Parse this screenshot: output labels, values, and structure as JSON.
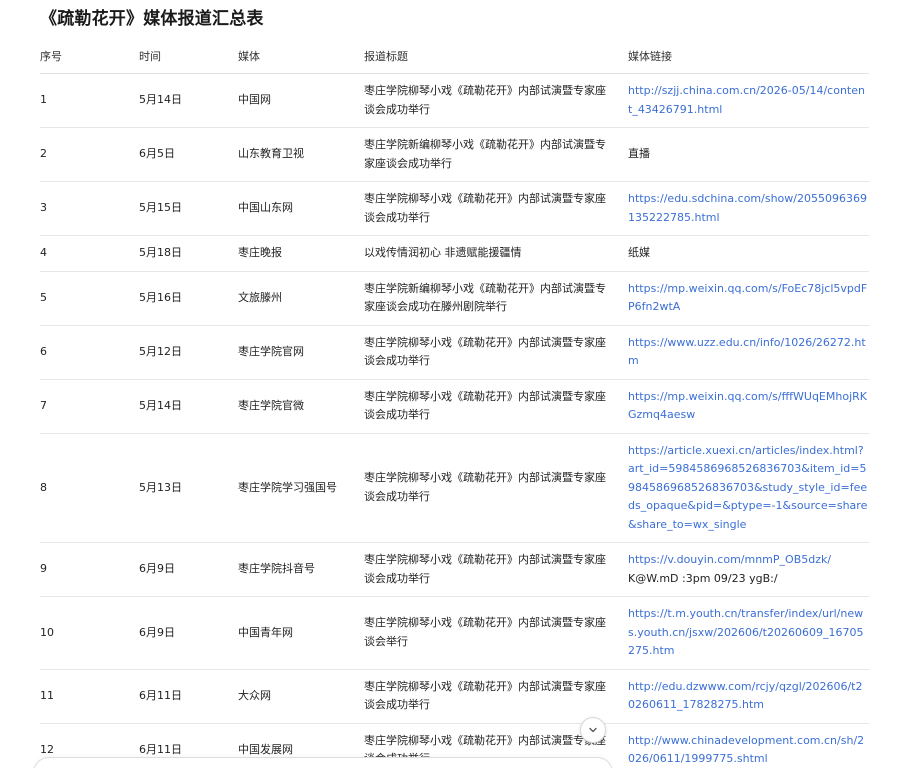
{
  "document": {
    "title": "《疏勒花开》媒体报道汇总表"
  },
  "table": {
    "headers": {
      "no": "序号",
      "time": "时间",
      "media": "媒体",
      "title": "报道标题",
      "link": "媒体链接"
    },
    "rows": [
      {
        "no": "1",
        "time": "5月14日",
        "media": "中国网",
        "title": "枣庄学院柳琴小戏《疏勒花开》内部试演暨专家座谈会成功举行",
        "link": "http://szjj.china.com.cn/2026-05/14/content_43426791.html",
        "is_link": true
      },
      {
        "no": "2",
        "time": "6月5日",
        "media": "山东教育卫视",
        "title": "枣庄学院新编柳琴小戏《疏勒花开》内部试演暨专家座谈会成功举行",
        "link": "直播",
        "is_link": false
      },
      {
        "no": "3",
        "time": "5月15日",
        "media": "中国山东网",
        "title": "枣庄学院柳琴小戏《疏勒花开》内部试演暨专家座谈会成功举行",
        "link": "https://edu.sdchina.com/show/2055096369135222785.html",
        "is_link": true
      },
      {
        "no": "4",
        "time": "5月18日",
        "media": "枣庄晚报",
        "title": "以戏传情润初心 非遗赋能援疆情",
        "link": "纸媒",
        "is_link": false
      },
      {
        "no": "5",
        "time": "5月16日",
        "media": "文旅滕州",
        "title": "枣庄学院新编柳琴小戏《疏勒花开》内部试演暨专家座谈会成功在滕州剧院举行",
        "link": "https://mp.weixin.qq.com/s/FoEc78jcl5vpdFP6fn2wtA",
        "is_link": true
      },
      {
        "no": "6",
        "time": "5月12日",
        "media": "枣庄学院官网",
        "title": "枣庄学院柳琴小戏《疏勒花开》内部试演暨专家座谈会成功举行",
        "link": "https://www.uzz.edu.cn/info/1026/26272.htm",
        "is_link": true
      },
      {
        "no": "7",
        "time": "5月14日",
        "media": "枣庄学院官微",
        "title": "枣庄学院柳琴小戏《疏勒花开》内部试演暨专家座谈会成功举行",
        "link": "https://mp.weixin.qq.com/s/fffWUqEMhojRKGzmq4aesw",
        "is_link": true
      },
      {
        "no": "8",
        "time": "5月13日",
        "media": "枣庄学院学习强国号",
        "title": "枣庄学院柳琴小戏《疏勒花开》内部试演暨专家座谈会成功举行",
        "link": "https://article.xuexi.cn/articles/index.html?art_id=5984586968526836703&item_id=5984586968526836703&study_style_id=feeds_opaque&pid=&ptype=-1&source=share&share_to=wx_single",
        "is_link": true
      },
      {
        "no": "9",
        "time": "6月9日",
        "media": "枣庄学院抖音号",
        "title": "枣庄学院柳琴小戏《疏勒花开》内部试演暨专家座谈会成功举行",
        "link": "https://v.douyin.com/mnmP_OB5dzk/",
        "link_extra": "K@W.mD :3pm 09/23 ygB:/",
        "is_link": true
      },
      {
        "no": "10",
        "time": "6月9日",
        "media": "中国青年网",
        "title": "枣庄学院柳琴小戏《疏勒花开》内部试演暨专家座谈会举行",
        "link": "https://t.m.youth.cn/transfer/index/url/news.youth.cn/jsxw/202606/t20260609_16705275.htm",
        "is_link": true
      },
      {
        "no": "11",
        "time": "6月11日",
        "media": "大众网",
        "title": "枣庄学院柳琴小戏《疏勒花开》内部试演暨专家座谈会成功举行",
        "link": "http://edu.dzwww.com/rcjy/qzgl/202606/t20260611_17828275.htm",
        "is_link": true
      },
      {
        "no": "12",
        "time": "6月11日",
        "media": "中国发展网",
        "title": "枣庄学院柳琴小戏《疏勒花开》内部试演暨专家座谈会成功举行",
        "link": "http://www.chinadevelopment.com.cn/sh/2026/0611/1999775.shtml",
        "is_link": true
      }
    ]
  },
  "icons": {
    "scroll_down": "chevron-down-icon"
  }
}
